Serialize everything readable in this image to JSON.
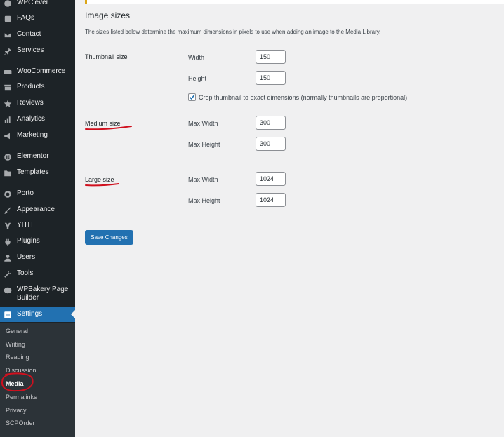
{
  "sidebar": {
    "items": [
      {
        "label": "WPClever",
        "icon": "wpclever-icon"
      },
      {
        "label": "FAQs",
        "icon": "faq-icon"
      },
      {
        "label": "Contact",
        "icon": "mail-icon"
      },
      {
        "label": "Services",
        "icon": "pin-icon"
      },
      {
        "label": "WooCommerce",
        "icon": "woocommerce-icon"
      },
      {
        "label": "Products",
        "icon": "archive-icon"
      },
      {
        "label": "Reviews",
        "icon": "star-icon"
      },
      {
        "label": "Analytics",
        "icon": "bar-chart-icon"
      },
      {
        "label": "Marketing",
        "icon": "megaphone-icon"
      },
      {
        "label": "Elementor",
        "icon": "elementor-icon"
      },
      {
        "label": "Templates",
        "icon": "folder-icon"
      },
      {
        "label": "Porto",
        "icon": "porto-icon"
      },
      {
        "label": "Appearance",
        "icon": "brush-icon"
      },
      {
        "label": "YITH",
        "icon": "yith-icon"
      },
      {
        "label": "Plugins",
        "icon": "plug-icon"
      },
      {
        "label": "Users",
        "icon": "user-icon"
      },
      {
        "label": "Tools",
        "icon": "wrench-icon"
      },
      {
        "label": "WPBakery Page",
        "label2": "Builder",
        "icon": "wpbakery-icon"
      },
      {
        "label": "Settings",
        "icon": "settings-icon",
        "active": true
      }
    ],
    "submenu": [
      "General",
      "Writing",
      "Reading",
      "Discussion",
      "Media",
      "Permalinks",
      "Privacy",
      "SCPOrder"
    ],
    "current_submenu": "Media"
  },
  "main": {
    "section_title": "Image sizes",
    "description": "The sizes listed below determine the maximum dimensions in pixels to use when adding an image to the Media Library.",
    "thumbnail": {
      "label": "Thumbnail size",
      "width_label": "Width",
      "width_value": "150",
      "height_label": "Height",
      "height_value": "150",
      "crop_checked": true,
      "crop_label": "Crop thumbnail to exact dimensions (normally thumbnails are proportional)"
    },
    "medium": {
      "label": "Medium size",
      "max_width_label": "Max Width",
      "max_width_value": "300",
      "max_height_label": "Max Height",
      "max_height_value": "300"
    },
    "large": {
      "label": "Large size",
      "max_width_label": "Max Width",
      "max_width_value": "1024",
      "max_height_label": "Max Height",
      "max_height_value": "1024"
    },
    "save_button": "Save Changes"
  },
  "colors": {
    "sidebar_bg": "#1d2327",
    "submenu_bg": "#2c3338",
    "accent": "#2271b1",
    "annotation_red": "#d0101e"
  }
}
